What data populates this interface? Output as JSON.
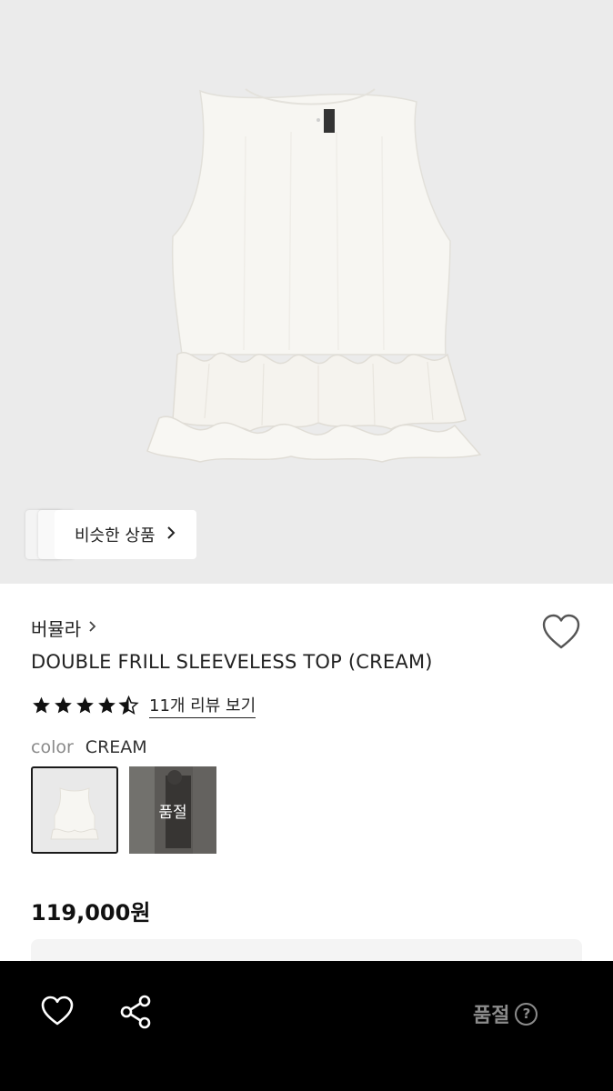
{
  "hero": {
    "image": "double-frill-sleeveless-top-cream-photo"
  },
  "similar_products": {
    "label": "비슷한 상품",
    "icon": "chevron-right-icon"
  },
  "product": {
    "brand": "버뮬라",
    "title": "DOUBLE FRILL SLEEVELESS TOP (CREAM)",
    "rating": 4.5,
    "review_link": "11개 리뷰 보기",
    "color_label": "color",
    "color_value": "CREAM",
    "price": "119,000원"
  },
  "swatches": [
    {
      "name": "cream",
      "selected": true
    },
    {
      "name": "other",
      "soldout_label": "품절"
    }
  ],
  "bottom_bar": {
    "soldout_label": "품절",
    "help_glyph": "?",
    "icons": [
      "heart-icon",
      "share-icon",
      "help-icon"
    ],
    "background": "#000000"
  }
}
